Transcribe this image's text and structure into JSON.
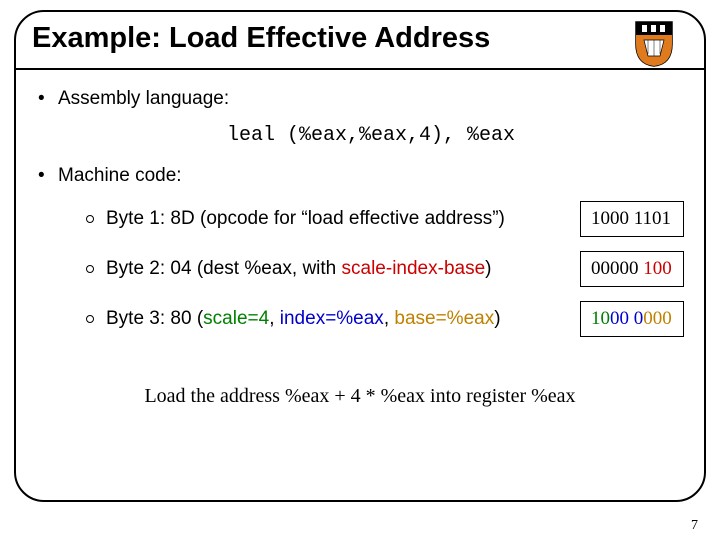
{
  "title": "Example: Load Effective Address",
  "bullets": {
    "asm_label": "Assembly language:",
    "code": "leal  (%eax,%eax,4), %eax",
    "mc_label": "Machine code:",
    "bytes": [
      {
        "prefix": "Byte 1: 8D (opcode for “load effective address”)",
        "bin": {
          "plain": "1000 1101"
        }
      },
      {
        "prefix": "Byte 2: 04 (dest %eax, with ",
        "sib": "scale-index-base",
        "suffix": ")",
        "bin": {
          "g1": "00",
          "g2": "000",
          "g3": "100",
          "sp1": " ",
          "sp2": " "
        }
      },
      {
        "prefix": "Byte 3: 80 (",
        "scale": "scale=4",
        "sep1": ", ",
        "idx": "index=%eax",
        "sep2": ", ",
        "base": "base=%eax",
        "suffix": ")",
        "bin": {
          "g1": "10",
          "g2": "00 0",
          "g3": "000"
        }
      }
    ]
  },
  "footer": "Load the address %eax + 4 * %eax into register %eax",
  "page": "7"
}
